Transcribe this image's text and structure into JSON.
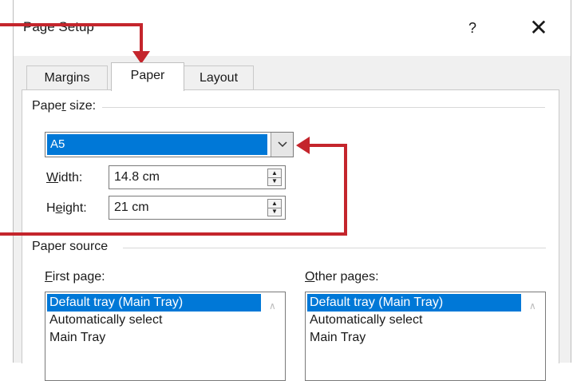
{
  "dialog": {
    "title": "Page Setup",
    "help_label": "?",
    "close_label": "✕"
  },
  "tabs": [
    {
      "label": "Margins",
      "active": false
    },
    {
      "label": "Paper",
      "active": true
    },
    {
      "label": "Layout",
      "active": false
    }
  ],
  "paper_size": {
    "group_label_pre": "Pape",
    "group_label_key": "r",
    "group_label_post": " size:",
    "selected": "A5",
    "dropdown_icon": "chevron-down-icon",
    "width_label_pre": "",
    "width_label_key": "W",
    "width_label_post": "idth:",
    "width_value": "14.8 cm",
    "height_label_pre": "H",
    "height_label_key": "e",
    "height_label_post": "ight:",
    "height_value": "21 cm"
  },
  "paper_source": {
    "group_label": "Paper source",
    "first_page_label_key": "F",
    "first_page_label_post": "irst page:",
    "other_pages_label_key": "O",
    "other_pages_label_post": "ther pages:",
    "first_page_items": [
      "Default tray (Main Tray)",
      "Automatically select",
      "Main Tray"
    ],
    "other_pages_items": [
      "Default tray (Main Tray)",
      "Automatically select",
      "Main Tray"
    ],
    "selected_index": 0
  },
  "annotations": {
    "callout_color": "#c4252c"
  }
}
